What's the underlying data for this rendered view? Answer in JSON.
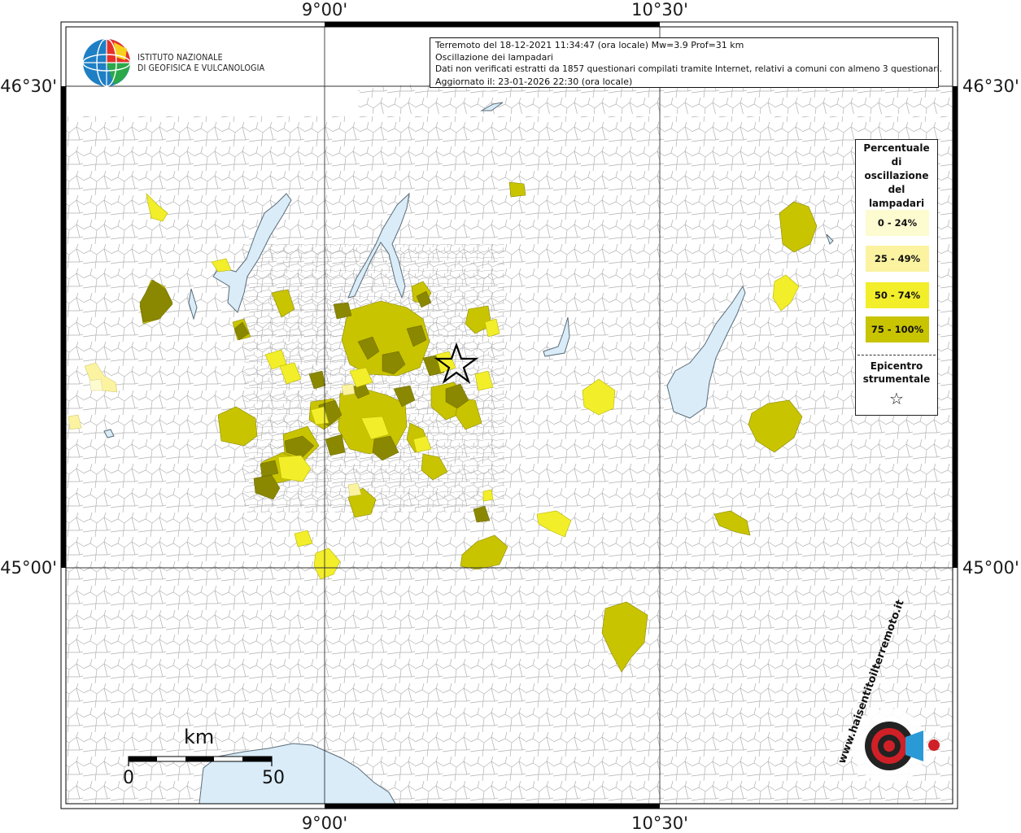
{
  "map": {
    "axis_labels": {
      "top": [
        "9°00'",
        "10°30'"
      ],
      "bottom": [
        "9°00'",
        "10°30'"
      ],
      "left": [
        "46°30'",
        "45°00'"
      ],
      "right": [
        "46°30'",
        "45°00'"
      ]
    },
    "info_lines": [
      "Terremoto del 18-12-2021 11:34:47 (ora locale) Mw=3.9 Prof=31 km",
      "Oscillazione dei lampadari",
      "Dati non verificati estratti da 1857 questionari compilati tramite Internet, relativi a comuni con almeno 3 questionari.",
      "Aggiornato il: 23-01-2026 22:30 (ora locale)"
    ],
    "logo": {
      "line1": "ISTITUTO NAZIONALE",
      "line2": "DI GEOFISICA E VULCANOLOGIA"
    },
    "legend": {
      "title": [
        "Percentuale",
        "di",
        "oscillazione",
        "del",
        "lampadari"
      ],
      "items": [
        {
          "label": "0 - 24%",
          "color": "#fdfbd0"
        },
        {
          "label": "25 - 49%",
          "color": "#fbf3a0"
        },
        {
          "label": "50 - 74%",
          "color": "#f2ee2a"
        },
        {
          "label": "75 - 100%",
          "color": "#c9c400"
        }
      ],
      "epicenter_label": [
        "Epicentro",
        "strumentale"
      ],
      "epicenter_symbol": "☆"
    },
    "scale": {
      "unit": "km",
      "min": "0",
      "max": "50"
    },
    "watermark": "www.haisentitoilterremoto.it",
    "colors": {
      "lake": "#d9ecf8",
      "dark_olive": "#8a8700",
      "olive": "#c9c400",
      "yellow": "#f2ee2a",
      "pale": "#fbf3a0"
    }
  }
}
